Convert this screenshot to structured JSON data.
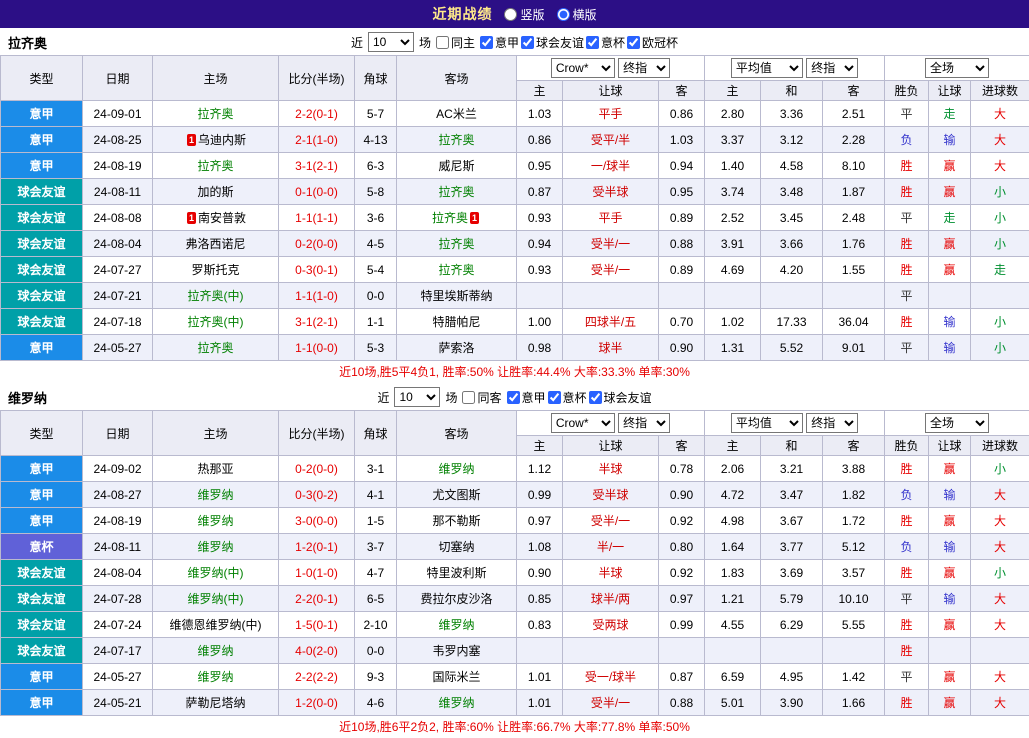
{
  "topbar": {
    "title": "近期战绩",
    "layout_options": [
      {
        "label": "竖版",
        "checked": false
      },
      {
        "label": "横版",
        "checked": true
      }
    ]
  },
  "filter_labels": {
    "near": "近",
    "games": "场"
  },
  "table_header": {
    "cols": [
      "类型",
      "日期",
      "主场",
      "比分(半场)",
      "角球",
      "客场"
    ],
    "selects_group1": [
      "Crow*",
      "终指"
    ],
    "selects_group2": [
      "平均值",
      "终指"
    ],
    "selects_group3": [
      "全场"
    ],
    "sub": [
      "主",
      "让球",
      "客",
      "主",
      "和",
      "客",
      "胜负",
      "让球",
      "进球数"
    ]
  },
  "sections": [
    {
      "team": "拉齐奥",
      "filter": {
        "count": "10",
        "same_label": "同主",
        "same_checked": false,
        "leagues": [
          {
            "label": "意甲",
            "checked": true
          },
          {
            "label": "球会友谊",
            "checked": true
          },
          {
            "label": "意杯",
            "checked": true
          },
          {
            "label": "欧冠杯",
            "checked": true
          }
        ]
      },
      "rows": [
        {
          "type": "意甲",
          "date": "24-09-01",
          "home": {
            "name": "拉齐奥",
            "focus": true
          },
          "score": "2-2(0-1)",
          "corner": "5-7",
          "away": {
            "name": "AC米兰",
            "focus": false
          },
          "odds": [
            "1.03",
            "平手",
            "0.86",
            "2.80",
            "3.36",
            "2.51"
          ],
          "results": [
            "平",
            "走",
            "大"
          ]
        },
        {
          "type": "意甲",
          "date": "24-08-25",
          "home": {
            "name": "乌迪内斯",
            "focus": false,
            "badge": {
              "pos": "pre",
              "text": "1"
            }
          },
          "score": "2-1(1-0)",
          "corner": "4-13",
          "away": {
            "name": "拉齐奥",
            "focus": true
          },
          "odds": [
            "0.86",
            "受平/半",
            "1.03",
            "3.37",
            "3.12",
            "2.28"
          ],
          "results": [
            "负",
            "输",
            "大"
          ]
        },
        {
          "type": "意甲",
          "date": "24-08-19",
          "home": {
            "name": "拉齐奥",
            "focus": true
          },
          "score": "3-1(2-1)",
          "corner": "6-3",
          "away": {
            "name": "威尼斯",
            "focus": false
          },
          "odds": [
            "0.95",
            "一/球半",
            "0.94",
            "1.40",
            "4.58",
            "8.10"
          ],
          "results": [
            "胜",
            "赢",
            "大"
          ]
        },
        {
          "type": "球会友谊",
          "date": "24-08-11",
          "home": {
            "name": "加的斯",
            "focus": false
          },
          "score": "0-1(0-0)",
          "corner": "5-8",
          "away": {
            "name": "拉齐奥",
            "focus": true
          },
          "odds": [
            "0.87",
            "受半球",
            "0.95",
            "3.74",
            "3.48",
            "1.87"
          ],
          "results": [
            "胜",
            "赢",
            "小"
          ]
        },
        {
          "type": "球会友谊",
          "date": "24-08-08",
          "home": {
            "name": "南安普敦",
            "focus": false,
            "badge": {
              "pos": "pre",
              "text": "1"
            }
          },
          "score": "1-1(1-1)",
          "corner": "3-6",
          "away": {
            "name": "拉齐奥",
            "focus": true,
            "badge": {
              "pos": "post",
              "text": "1"
            }
          },
          "odds": [
            "0.93",
            "平手",
            "0.89",
            "2.52",
            "3.45",
            "2.48"
          ],
          "results": [
            "平",
            "走",
            "小"
          ]
        },
        {
          "type": "球会友谊",
          "date": "24-08-04",
          "home": {
            "name": "弗洛西诺尼",
            "focus": false
          },
          "score": "0-2(0-0)",
          "corner": "4-5",
          "away": {
            "name": "拉齐奥",
            "focus": true
          },
          "odds": [
            "0.94",
            "受半/一",
            "0.88",
            "3.91",
            "3.66",
            "1.76"
          ],
          "results": [
            "胜",
            "赢",
            "小"
          ]
        },
        {
          "type": "球会友谊",
          "date": "24-07-27",
          "home": {
            "name": "罗斯托克",
            "focus": false
          },
          "score": "0-3(0-1)",
          "corner": "5-4",
          "away": {
            "name": "拉齐奥",
            "focus": true
          },
          "odds": [
            "0.93",
            "受半/一",
            "0.89",
            "4.69",
            "4.20",
            "1.55"
          ],
          "results": [
            "胜",
            "赢",
            "走"
          ]
        },
        {
          "type": "球会友谊",
          "date": "24-07-21",
          "home": {
            "name": "拉齐奥(中)",
            "focus": true
          },
          "score": "1-1(1-0)",
          "corner": "0-0",
          "away": {
            "name": "特里埃斯蒂纳",
            "focus": false
          },
          "odds": [
            "",
            "",
            "",
            "",
            "",
            ""
          ],
          "results": [
            "平",
            "",
            ""
          ]
        },
        {
          "type": "球会友谊",
          "date": "24-07-18",
          "home": {
            "name": "拉齐奥(中)",
            "focus": true
          },
          "score": "3-1(2-1)",
          "corner": "1-1",
          "away": {
            "name": "特腊帕尼",
            "focus": false
          },
          "odds": [
            "1.00",
            "四球半/五",
            "0.70",
            "1.02",
            "17.33",
            "36.04"
          ],
          "results": [
            "胜",
            "输",
            "小"
          ]
        },
        {
          "type": "意甲",
          "date": "24-05-27",
          "home": {
            "name": "拉齐奥",
            "focus": true
          },
          "score": "1-1(0-0)",
          "corner": "5-3",
          "away": {
            "name": "萨索洛",
            "focus": false
          },
          "odds": [
            "0.98",
            "球半",
            "0.90",
            "1.31",
            "5.52",
            "9.01"
          ],
          "results": [
            "平",
            "输",
            "小"
          ]
        }
      ],
      "summary": "近10场,胜5平4负1, 胜率:50% 让胜率:44.4% 大率:33.3% 单率:30%"
    },
    {
      "team": "维罗纳",
      "filter": {
        "count": "10",
        "same_label": "同客",
        "same_checked": false,
        "leagues": [
          {
            "label": "意甲",
            "checked": true
          },
          {
            "label": "意杯",
            "checked": true
          },
          {
            "label": "球会友谊",
            "checked": true
          }
        ]
      },
      "rows": [
        {
          "type": "意甲",
          "date": "24-09-02",
          "home": {
            "name": "热那亚",
            "focus": false
          },
          "score": "0-2(0-0)",
          "corner": "3-1",
          "away": {
            "name": "维罗纳",
            "focus": true
          },
          "odds": [
            "1.12",
            "半球",
            "0.78",
            "2.06",
            "3.21",
            "3.88"
          ],
          "results": [
            "胜",
            "赢",
            "小"
          ]
        },
        {
          "type": "意甲",
          "date": "24-08-27",
          "home": {
            "name": "维罗纳",
            "focus": true
          },
          "score": "0-3(0-2)",
          "corner": "4-1",
          "away": {
            "name": "尤文图斯",
            "focus": false
          },
          "odds": [
            "0.99",
            "受半球",
            "0.90",
            "4.72",
            "3.47",
            "1.82"
          ],
          "results": [
            "负",
            "输",
            "大"
          ]
        },
        {
          "type": "意甲",
          "date": "24-08-19",
          "home": {
            "name": "维罗纳",
            "focus": true
          },
          "score": "3-0(0-0)",
          "corner": "1-5",
          "away": {
            "name": "那不勒斯",
            "focus": false
          },
          "odds": [
            "0.97",
            "受半/一",
            "0.92",
            "4.98",
            "3.67",
            "1.72"
          ],
          "results": [
            "胜",
            "赢",
            "大"
          ]
        },
        {
          "type": "意杯",
          "date": "24-08-11",
          "home": {
            "name": "维罗纳",
            "focus": true
          },
          "score": "1-2(0-1)",
          "corner": "3-7",
          "away": {
            "name": "切塞纳",
            "focus": false
          },
          "odds": [
            "1.08",
            "半/一",
            "0.80",
            "1.64",
            "3.77",
            "5.12"
          ],
          "results": [
            "负",
            "输",
            "大"
          ]
        },
        {
          "type": "球会友谊",
          "date": "24-08-04",
          "home": {
            "name": "维罗纳(中)",
            "focus": true
          },
          "score": "1-0(1-0)",
          "corner": "4-7",
          "away": {
            "name": "特里波利斯",
            "focus": false
          },
          "odds": [
            "0.90",
            "半球",
            "0.92",
            "1.83",
            "3.69",
            "3.57"
          ],
          "results": [
            "胜",
            "赢",
            "小"
          ]
        },
        {
          "type": "球会友谊",
          "date": "24-07-28",
          "home": {
            "name": "维罗纳(中)",
            "focus": true
          },
          "score": "2-2(0-1)",
          "corner": "6-5",
          "away": {
            "name": "费拉尔皮沙洛",
            "focus": false
          },
          "odds": [
            "0.85",
            "球半/两",
            "0.97",
            "1.21",
            "5.79",
            "10.10"
          ],
          "results": [
            "平",
            "输",
            "大"
          ]
        },
        {
          "type": "球会友谊",
          "date": "24-07-24",
          "home": {
            "name": "维德恩维罗纳(中)",
            "focus": false
          },
          "score": "1-5(0-1)",
          "corner": "2-10",
          "away": {
            "name": "维罗纳",
            "focus": true
          },
          "odds": [
            "0.83",
            "受两球",
            "0.99",
            "4.55",
            "6.29",
            "5.55"
          ],
          "results": [
            "胜",
            "赢",
            "大"
          ]
        },
        {
          "type": "球会友谊",
          "date": "24-07-17",
          "home": {
            "name": "维罗纳",
            "focus": true
          },
          "score": "4-0(2-0)",
          "corner": "0-0",
          "away": {
            "name": "韦罗内塞",
            "focus": false
          },
          "odds": [
            "",
            "",
            "",
            "",
            "",
            ""
          ],
          "results": [
            "胜",
            "",
            ""
          ]
        },
        {
          "type": "意甲",
          "date": "24-05-27",
          "home": {
            "name": "维罗纳",
            "focus": true
          },
          "score": "2-2(2-2)",
          "corner": "9-3",
          "away": {
            "name": "国际米兰",
            "focus": false
          },
          "odds": [
            "1.01",
            "受一/球半",
            "0.87",
            "6.59",
            "4.95",
            "1.42"
          ],
          "results": [
            "平",
            "赢",
            "大"
          ]
        },
        {
          "type": "意甲",
          "date": "24-05-21",
          "home": {
            "name": "萨勒尼塔纳",
            "focus": false
          },
          "score": "1-2(0-0)",
          "corner": "4-6",
          "away": {
            "name": "维罗纳",
            "focus": true
          },
          "odds": [
            "1.01",
            "受半/一",
            "0.88",
            "5.01",
            "3.90",
            "1.66"
          ],
          "results": [
            "胜",
            "赢",
            "大"
          ]
        }
      ],
      "summary": "近10场,胜6平2负2, 胜率:60% 让胜率:66.7% 大率:77.8% 单率:50%"
    }
  ]
}
